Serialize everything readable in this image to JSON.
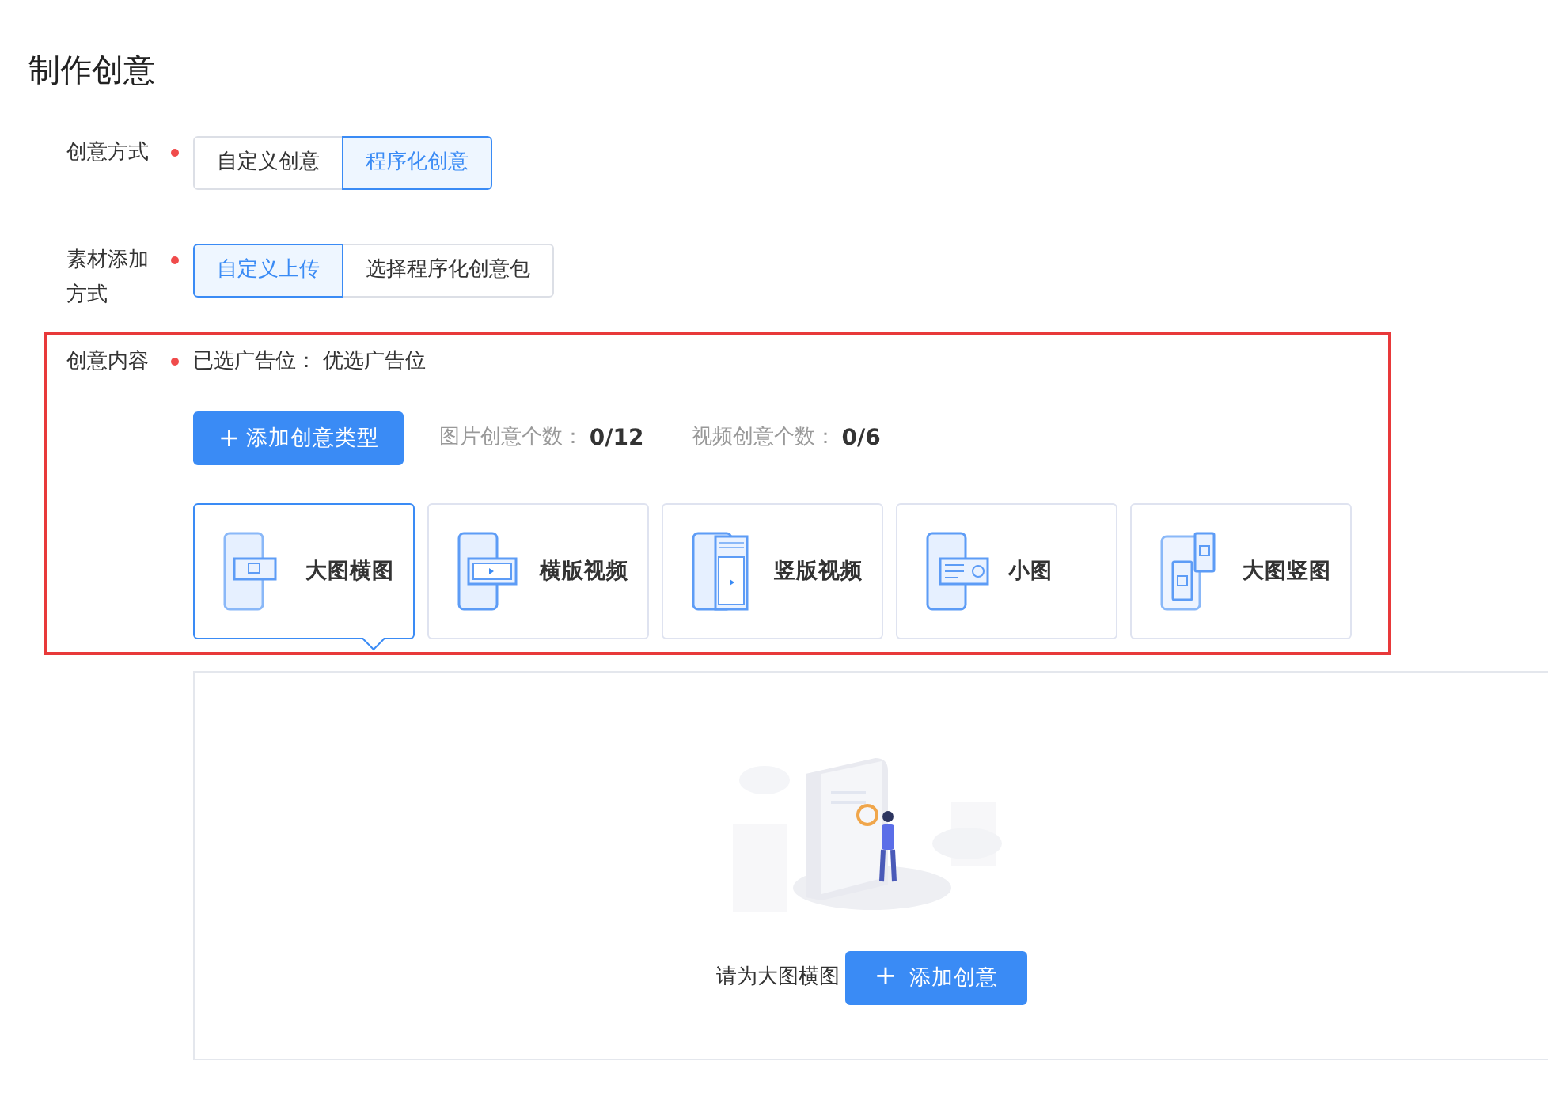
{
  "title": "制作创意",
  "form": [
    {
      "label": "创意方式",
      "required": true,
      "options": [
        {
          "label": "自定义创意",
          "selected": false
        },
        {
          "label": "程序化创意",
          "selected": true
        }
      ]
    },
    {
      "label": "素材添加方式",
      "required": true,
      "options": [
        {
          "label": "自定义上传",
          "selected": true
        },
        {
          "label": "选择程序化创意包",
          "selected": false
        }
      ]
    }
  ],
  "content": {
    "label": "创意内容",
    "required": true,
    "highlighted": true,
    "placement_label": "已选广告位：",
    "placement_value": "优选广告位",
    "add_type_button": {
      "icon": "+",
      "label": "添加创意类型"
    },
    "counts": [
      {
        "label": "图片创意个数：",
        "value": "0/12"
      },
      {
        "label": "视频创意个数：",
        "value": "0/6"
      }
    ],
    "types": [
      {
        "label": "大图横图",
        "selected": true
      },
      {
        "label": "横版视频",
        "selected": false
      },
      {
        "label": "竖版视频",
        "selected": false
      },
      {
        "label": "小图",
        "selected": false
      },
      {
        "label": "大图竖图",
        "selected": false
      }
    ]
  },
  "empty_panel": {
    "message": "请为大图横图",
    "button": {
      "icon": "+",
      "label": "添加创意"
    }
  }
}
